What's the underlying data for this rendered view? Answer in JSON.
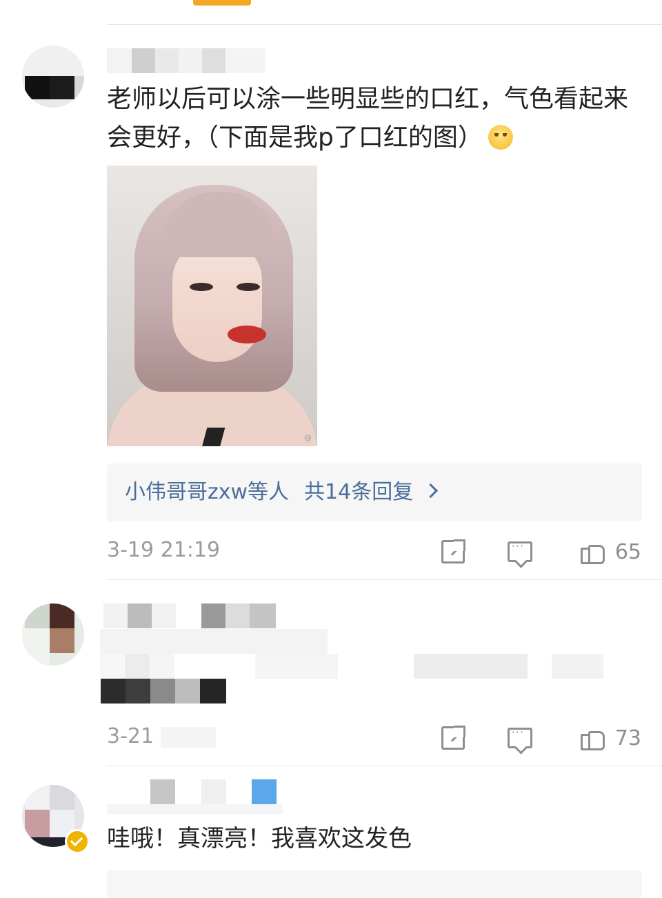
{
  "comments": [
    {
      "text": "老师以后可以涂一些明显些的口红，气色看起来会更好，（下面是我p了口红的图）",
      "emoji": "blush-emoji",
      "replies_label": "小伟哥哥zxw等人",
      "replies_count": "共14条回复",
      "time": "3-19 21:19",
      "likes": "65"
    },
    {
      "time": "3-21",
      "likes": "73"
    },
    {
      "text": "哇哦！真漂亮！我喜欢这发色"
    }
  ],
  "colors": {
    "accent": "#f5a623",
    "link": "#4a6d9a",
    "meta": "#9b9b9b",
    "verified": "#f0b400"
  },
  "icons": [
    "share-icon",
    "comment-icon",
    "like-icon",
    "chevron-right-icon",
    "verified-badge-icon"
  ]
}
